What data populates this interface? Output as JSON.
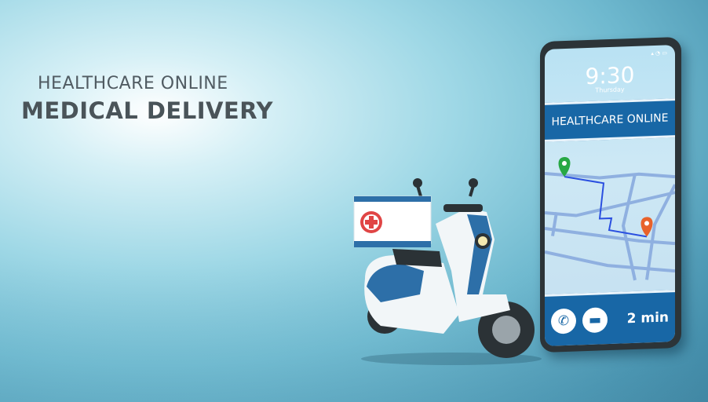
{
  "headline": {
    "line1": "HEALTHCARE ONLINE",
    "line2": "MEDICAL DELIVERY"
  },
  "phone": {
    "time": "9:30",
    "day": "Thursday",
    "status_icons": "▴ ◔ ▭",
    "header": "HEALTHCARE ONLINE",
    "call_icon": "phone-icon",
    "chat_icon": "chat-icon",
    "eta": "2 min"
  },
  "colors": {
    "brand_blue": "#1867a6",
    "pin_start": "#27a844",
    "pin_end": "#e8622b"
  }
}
